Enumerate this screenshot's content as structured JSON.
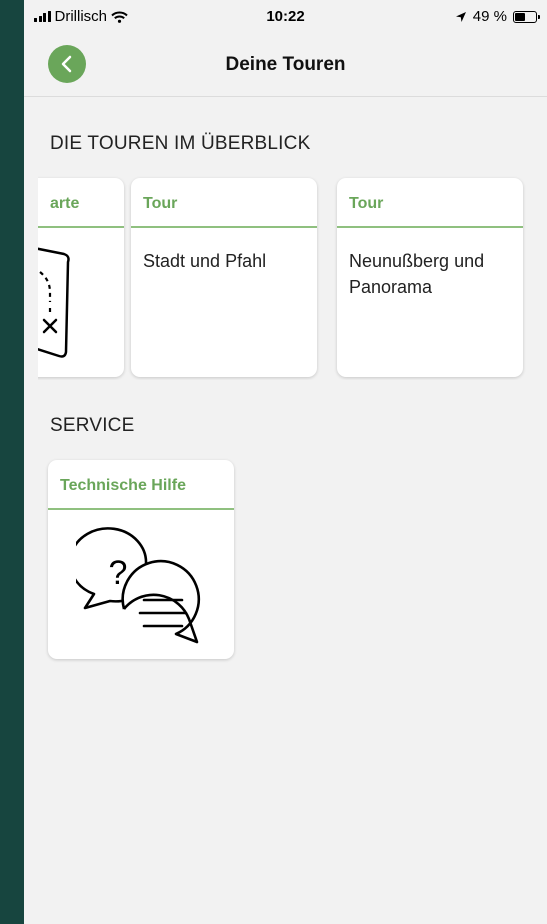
{
  "status_bar": {
    "carrier": "Drillisch",
    "time": "10:22",
    "battery": "49 %"
  },
  "header": {
    "title": "Deine Touren"
  },
  "tours_section": {
    "title": "DIE TOUREN IM ÜBERBLICK",
    "cards": [
      {
        "header": "arte",
        "icon": "treasure-map-icon"
      },
      {
        "header": "Tour",
        "text": "Stadt und Pfahl"
      },
      {
        "header": "Tour",
        "text": "Neunußberg und Panorama"
      }
    ]
  },
  "service_section": {
    "title": "SERVICE",
    "cards": [
      {
        "header": "Technische Hilfe",
        "icon": "help-chat-icon"
      }
    ]
  },
  "colors": {
    "accent": "#6aa65a",
    "background": "#f2f2f2",
    "frame": "#17453f"
  }
}
